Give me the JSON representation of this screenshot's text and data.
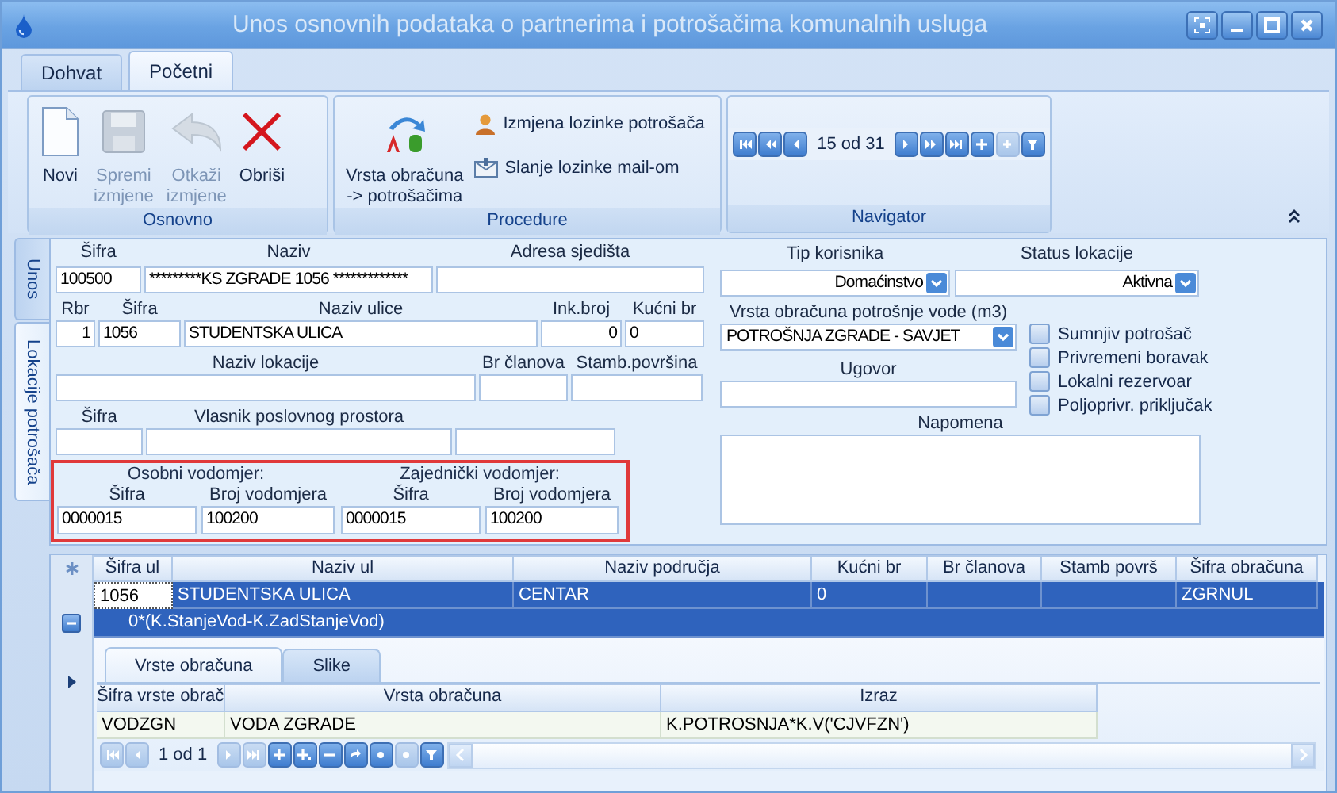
{
  "window": {
    "title": "Unos osnovnih podataka o partnerima i potrošačima komunalnih usluga"
  },
  "ribbon": {
    "tabs": [
      {
        "label": "Dohvat",
        "selected": false
      },
      {
        "label": "Početni",
        "selected": true
      }
    ],
    "groups": [
      {
        "title": "Osnovno",
        "buttons": [
          {
            "kind": "new",
            "label": "Novi",
            "disabled": false
          },
          {
            "kind": "save",
            "label": "Spremi\nizmjene",
            "disabled": true
          },
          {
            "kind": "cancel",
            "label": "Otkaži\nizmjene",
            "disabled": true
          },
          {
            "kind": "delete",
            "label": "Obriši",
            "disabled": false
          }
        ]
      },
      {
        "title": "Procedure",
        "buttons": [
          {
            "kind": "assign",
            "label": "Vrsta obračuna\n-> potrošačima"
          },
          {
            "kind": "password",
            "label": "Izmjena lozinke potrošača"
          },
          {
            "kind": "mail",
            "label": "Slanje lozinke mail-om"
          }
        ]
      }
    ],
    "navigator": {
      "title": "Navigator",
      "items": [
        {
          "kind": "first",
          "disabled": false
        },
        {
          "kind": "prev_page",
          "disabled": false
        },
        {
          "kind": "prev",
          "disabled": false
        },
        {
          "kind": "position",
          "text": "15 od 31"
        },
        {
          "kind": "next",
          "disabled": false
        },
        {
          "kind": "next_page",
          "disabled": false
        },
        {
          "kind": "last",
          "disabled": false
        },
        {
          "kind": "append",
          "disabled": false
        },
        {
          "kind": "insert",
          "disabled": true
        },
        {
          "kind": "filter",
          "disabled": false
        }
      ]
    }
  },
  "side_tabs": [
    {
      "label": "Unos",
      "selected": false
    },
    {
      "label": "Lokacije potrošača",
      "selected": true
    }
  ],
  "form": {
    "lines": [
      {
        "fields": [
          {
            "label": "Šifra",
            "value": "100500"
          },
          {
            "label": "Naziv",
            "value": "*********KS ZGRADE 1056 *************"
          },
          {
            "label": "Adresa sjedišta"
          }
        ]
      },
      {
        "fields": [
          {
            "label": "Rbr",
            "value": "1"
          },
          {
            "label": "Šifra",
            "value": "1056"
          },
          {
            "label": "Naziv ulice",
            "value": "STUDENTSKA ULICA"
          },
          {
            "label": "Ink.broj",
            "value": "0"
          },
          {
            "label": "Kućni br",
            "value": "0"
          }
        ]
      },
      {
        "fields": [
          {
            "label": "Naziv lokacije"
          },
          {
            "label": "Br članova"
          },
          {
            "label": "Stamb.površina"
          }
        ]
      },
      {
        "fields": [
          {
            "label": "Šifra"
          },
          {
            "label": "Vlasnik poslovnog prostora"
          }
        ],
        "trailing_blank": true
      }
    ],
    "meters": [
      {
        "title": "Osobni vodomjer:",
        "fields": [
          {
            "label": "Šifra",
            "value": "0000015"
          },
          {
            "label": "Broj vodomjera",
            "value": "100200"
          }
        ]
      },
      {
        "title": "Zajednički vodomjer:",
        "fields": [
          {
            "label": "Šifra",
            "value": "0000015"
          },
          {
            "label": "Broj vodomjera",
            "value": "100200"
          }
        ]
      }
    ],
    "user_type": {
      "label": "Tip korisnika",
      "value": "Domaćinstvo"
    },
    "location_status": {
      "label": "Status lokacije",
      "value": "Aktivna"
    },
    "billing_type": {
      "label": "Vrsta obračuna potrošnje vode (m3)",
      "value": "POTROŠNJA ZGRADE - SAVJET"
    },
    "contract": {
      "label": "Ugovor"
    },
    "note": {
      "label": "Napomena"
    },
    "checks": [
      {
        "label": "Sumnjiv potrošač",
        "checked": false
      },
      {
        "label": "Privremeni boravak",
        "checked": false
      },
      {
        "label": "Lokalni rezervoar",
        "checked": false
      },
      {
        "label": "Poljoprivr. priključak",
        "checked": false
      }
    ]
  },
  "grid": {
    "columns": [
      "Šifra ul",
      "Naziv ul",
      "Naziv područja",
      "Kućni br",
      "Br članova",
      "Stamb površ",
      "Šifra obračuna"
    ],
    "rows": [
      {
        "selected": true,
        "expanded": true,
        "cells": [
          {
            "text": "1056"
          },
          {
            "text": "STUDENTSKA ULICA"
          },
          {
            "text": "CENTAR"
          },
          {
            "text": "0"
          },
          {},
          {},
          {
            "text": "ZGRNUL"
          }
        ],
        "preview": "0*(K.StanjeVod-K.ZadStanjeVod)",
        "detail": {
          "tabs": [
            {
              "label": "Vrste obračuna",
              "selected": true
            },
            {
              "label": "Slike",
              "selected": false
            }
          ],
          "columns": [
            "Šifra vrste obrač",
            "Vrsta obračuna",
            "Izraz"
          ],
          "rows": [
            {
              "cells": [
                "VODZGN",
                "VODA ZGRADE",
                "K.POTROSNJA*K.V('CJVFZN')"
              ]
            }
          ],
          "navigator": [
            {
              "kind": "first",
              "disabled": true
            },
            {
              "kind": "prev",
              "disabled": true
            },
            {
              "kind": "position",
              "text": "1 od 1"
            },
            {
              "kind": "next",
              "disabled": true
            },
            {
              "kind": "last",
              "disabled": true
            },
            {
              "kind": "append",
              "disabled": false
            },
            {
              "kind": "append_child",
              "disabled": false
            },
            {
              "kind": "remove",
              "disabled": false
            },
            {
              "kind": "edit",
              "disabled": false
            },
            {
              "kind": "save",
              "disabled": false
            },
            {
              "kind": "cancel",
              "disabled": true
            },
            {
              "kind": "filter",
              "disabled": false
            }
          ]
        }
      }
    ]
  }
}
